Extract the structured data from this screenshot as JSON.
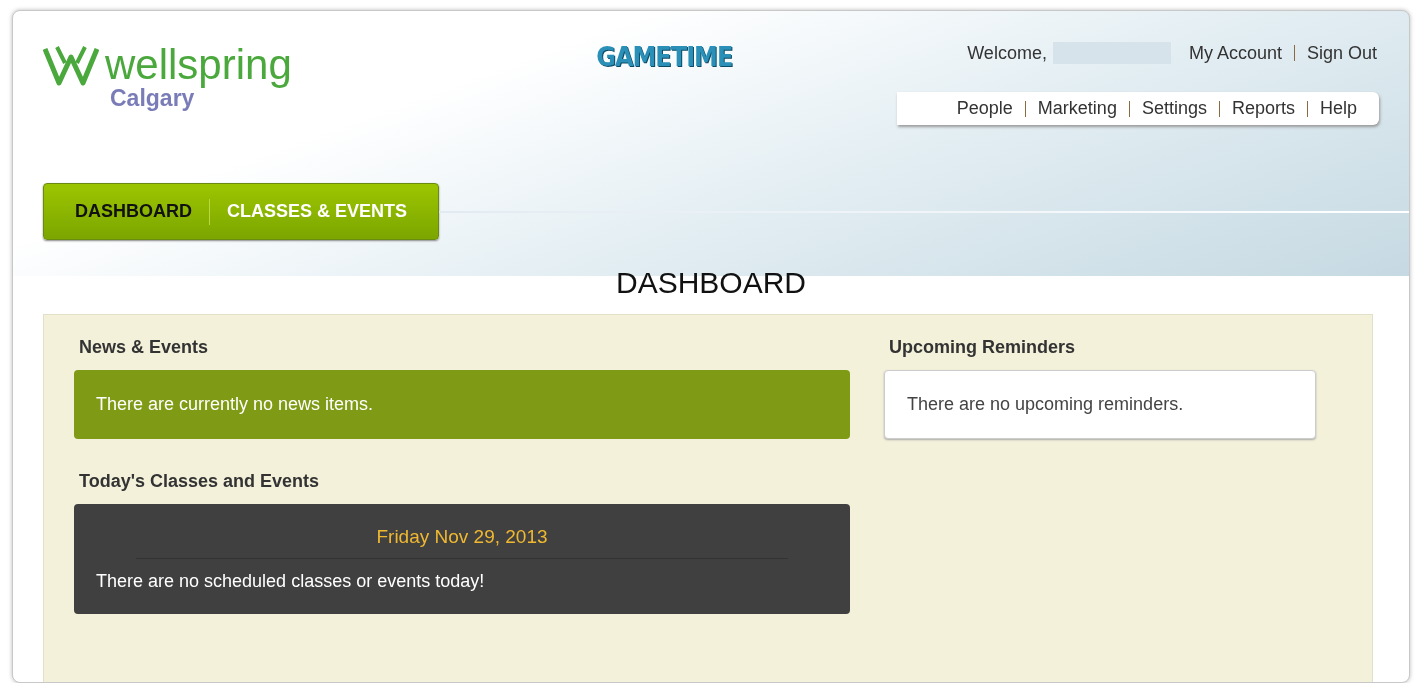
{
  "header": {
    "logo": {
      "name": "wellspring",
      "location": "Calgary"
    },
    "product": "GAMETIME",
    "welcome": "Welcome,",
    "account_links": [
      "My Account",
      "Sign Out"
    ],
    "nav": [
      "People",
      "Marketing",
      "Settings",
      "Reports",
      "Help"
    ]
  },
  "tabs": [
    {
      "label": "DASHBOARD",
      "selected": true
    },
    {
      "label": "CLASSES & EVENTS",
      "selected": false
    }
  ],
  "page_title": "DASHBOARD",
  "news": {
    "title": "News & Events",
    "message": "There are currently no news items."
  },
  "today": {
    "title": "Today's Classes and Events",
    "date": "Friday Nov 29, 2013",
    "message": "There are no scheduled classes or events today!"
  },
  "reminders": {
    "title": "Upcoming Reminders",
    "message": "There are no upcoming reminders."
  }
}
